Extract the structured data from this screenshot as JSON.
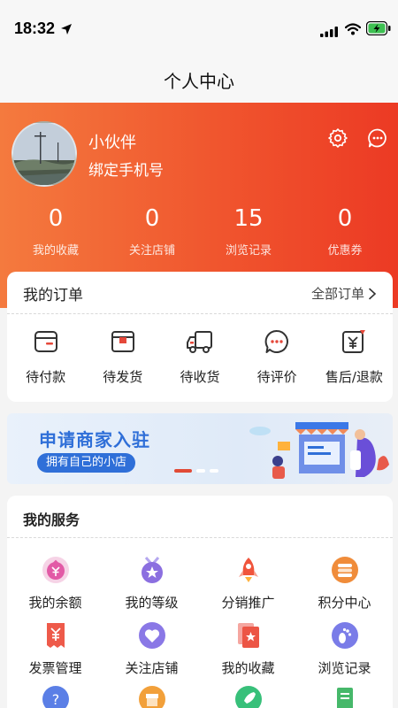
{
  "status_bar": {
    "time": "18:32",
    "icons": [
      "location-arrow-icon",
      "signal-icon",
      "wifi-icon",
      "battery-charging-icon"
    ]
  },
  "nav": {
    "title": "个人中心"
  },
  "profile": {
    "username": "小伙伴",
    "bind_phone": "绑定手机号",
    "icons": [
      "gear-icon",
      "message-icon"
    ],
    "stats": [
      {
        "value": "0",
        "label": "我的收藏"
      },
      {
        "value": "0",
        "label": "关注店铺"
      },
      {
        "value": "15",
        "label": "浏览记录"
      },
      {
        "value": "0",
        "label": "优惠券"
      }
    ]
  },
  "orders": {
    "title": "我的订单",
    "all_label": "全部订单",
    "items": [
      {
        "label": "待付款",
        "icon": "wallet-icon"
      },
      {
        "label": "待发货",
        "icon": "package-icon"
      },
      {
        "label": "待收货",
        "icon": "truck-icon"
      },
      {
        "label": "待评价",
        "icon": "comment-icon"
      },
      {
        "label": "售后/退款",
        "icon": "refund-icon"
      }
    ]
  },
  "banner": {
    "title": "申请商家入驻",
    "tag": "拥有自己的小店",
    "page_count": 3,
    "active_page": 1
  },
  "services": {
    "title": "我的服务",
    "items": [
      {
        "label": "我的余额",
        "icon": "balance-icon",
        "color": "#e25aa6"
      },
      {
        "label": "我的等级",
        "icon": "level-icon",
        "color": "#8b6fe0"
      },
      {
        "label": "分销推广",
        "icon": "rocket-icon",
        "color": "#f0553c"
      },
      {
        "label": "积分中心",
        "icon": "coins-icon",
        "color": "#f08c3a"
      },
      {
        "label": "发票管理",
        "icon": "invoice-icon",
        "color": "#ee5a4a"
      },
      {
        "label": "关注店铺",
        "icon": "heart-icon",
        "color": "#8a78e6"
      },
      {
        "label": "我的收藏",
        "icon": "favorites-icon",
        "color": "#ec5545"
      },
      {
        "label": "浏览记录",
        "icon": "footprint-icon",
        "color": "#7a7ce8"
      },
      {
        "label": "",
        "icon": "help-icon",
        "color": "#5b7fe6"
      },
      {
        "label": "",
        "icon": "shop-icon",
        "color": "#f2a03a"
      },
      {
        "label": "",
        "icon": "rocket-green-icon",
        "color": "#38c07a"
      },
      {
        "label": "",
        "icon": "document-icon",
        "color": "#46b86a"
      }
    ]
  }
}
